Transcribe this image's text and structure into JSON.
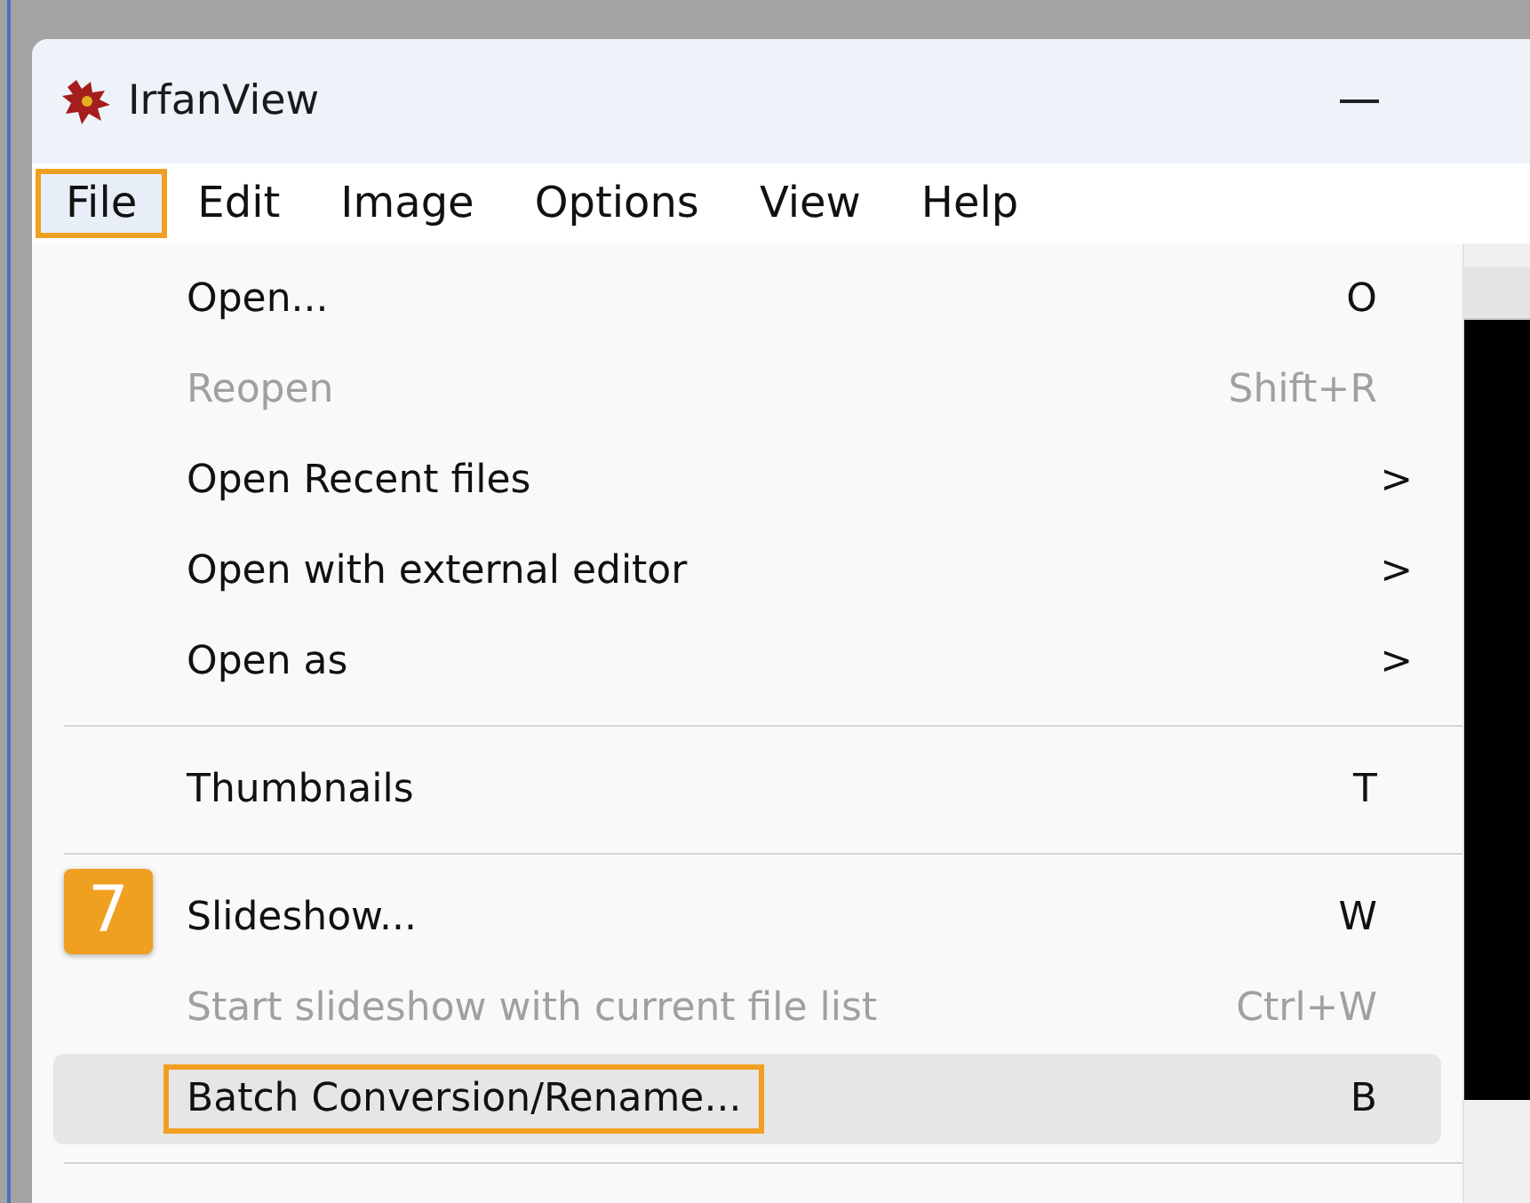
{
  "window": {
    "title": "IrfanView"
  },
  "menu_bar": [
    {
      "label": "File",
      "selected": true,
      "highlighted": true
    },
    {
      "label": "Edit",
      "selected": false,
      "highlighted": false
    },
    {
      "label": "Image",
      "selected": false,
      "highlighted": false
    },
    {
      "label": "Options",
      "selected": false,
      "highlighted": false
    },
    {
      "label": "View",
      "selected": false,
      "highlighted": false
    },
    {
      "label": "Help",
      "selected": false,
      "highlighted": false
    }
  ],
  "file_menu": [
    {
      "kind": "item",
      "label": "Open...",
      "shortcut": "O",
      "disabled": false,
      "hovered": false,
      "highlighted": false
    },
    {
      "kind": "item",
      "label": "Reopen",
      "shortcut": "Shift+R",
      "disabled": true,
      "hovered": false,
      "highlighted": false
    },
    {
      "kind": "item",
      "label": "Open Recent files",
      "arrow": ">",
      "disabled": false,
      "hovered": false,
      "highlighted": false
    },
    {
      "kind": "item",
      "label": "Open with external editor",
      "arrow": ">",
      "disabled": false,
      "hovered": false,
      "highlighted": false
    },
    {
      "kind": "item",
      "label": "Open as",
      "arrow": ">",
      "disabled": false,
      "hovered": false,
      "highlighted": false
    },
    {
      "kind": "separator"
    },
    {
      "kind": "item",
      "label": "Thumbnails",
      "shortcut": "T",
      "disabled": false,
      "hovered": false,
      "highlighted": false
    },
    {
      "kind": "separator"
    },
    {
      "kind": "item",
      "label": "Slideshow...",
      "shortcut": "W",
      "disabled": false,
      "hovered": false,
      "highlighted": false
    },
    {
      "kind": "item",
      "label": "Start slideshow with current file list",
      "shortcut": "Ctrl+W",
      "disabled": true,
      "hovered": false,
      "highlighted": false
    },
    {
      "kind": "item",
      "label": "Batch Conversion/Rename...",
      "shortcut": "B",
      "disabled": false,
      "hovered": true,
      "highlighted": true
    },
    {
      "kind": "separator"
    }
  ],
  "step_callout": {
    "text": "7"
  }
}
